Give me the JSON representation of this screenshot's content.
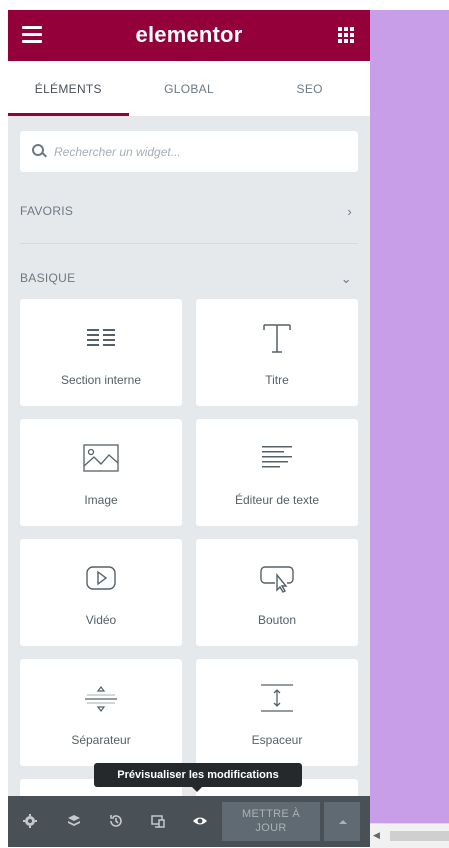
{
  "app": {
    "logo": "elementor",
    "brand_color": "#93003a",
    "canvas_color": "#c99ee8"
  },
  "tabs": [
    {
      "label": "ÉLÉMENTS",
      "active": true
    },
    {
      "label": "GLOBAL",
      "active": false
    },
    {
      "label": "SEO",
      "active": false
    }
  ],
  "search": {
    "placeholder": "Rechercher un widget..."
  },
  "categories": {
    "favoris": {
      "label": "FAVORIS",
      "chevron": "chevron-right-icon"
    },
    "basique": {
      "label": "BASIQUE",
      "chevron": "chevron-down-icon"
    }
  },
  "widgets": [
    {
      "label": "Section interne",
      "icon": "inner-section-icon"
    },
    {
      "label": "Titre",
      "icon": "heading-icon"
    },
    {
      "label": "Image",
      "icon": "image-icon"
    },
    {
      "label": "Éditeur de texte",
      "icon": "text-editor-icon"
    },
    {
      "label": "Vidéo",
      "icon": "video-icon"
    },
    {
      "label": "Bouton",
      "icon": "button-icon"
    },
    {
      "label": "Séparateur",
      "icon": "divider-icon"
    },
    {
      "label": "Espaceur",
      "icon": "spacer-icon"
    }
  ],
  "footer": {
    "tooltip": "Prévisualiser les modifications",
    "update_line1": "METTRE À",
    "update_line2": "JOUR",
    "icons": [
      "settings-icon",
      "navigator-icon",
      "history-icon",
      "responsive-icon",
      "preview-eye-icon"
    ]
  }
}
